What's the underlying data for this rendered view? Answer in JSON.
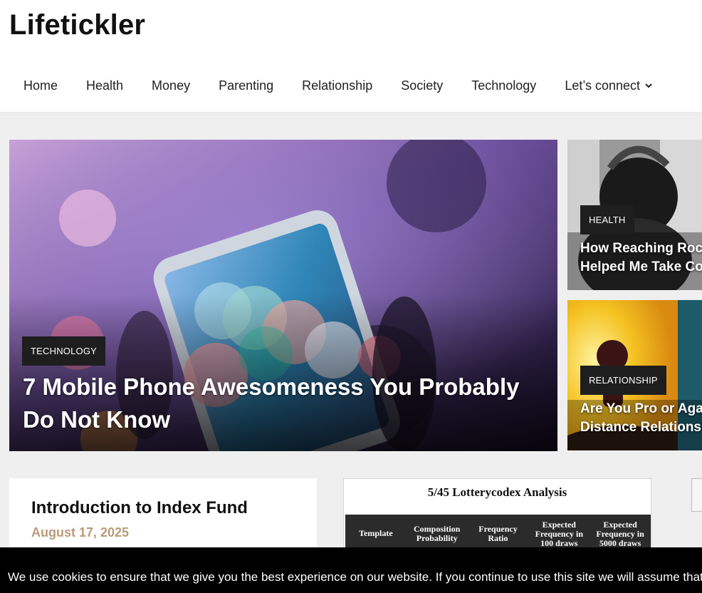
{
  "site": {
    "title": "Lifetickler"
  },
  "nav": {
    "items": [
      {
        "label": "Home"
      },
      {
        "label": "Health"
      },
      {
        "label": "Money"
      },
      {
        "label": "Parenting"
      },
      {
        "label": "Relationship"
      },
      {
        "label": "Society"
      },
      {
        "label": "Technology"
      },
      {
        "label": "Let’s connect",
        "icon": "chevron-down-icon"
      }
    ]
  },
  "hero": {
    "main": {
      "category": "TECHNOLOGY",
      "title": "7 Mobile Phone Awesomeness You Probably Do Not Know"
    },
    "side": [
      {
        "category": "HEALTH",
        "title_line1": "How Reaching Rock",
        "title_line2": "Helped Me Take Con"
      },
      {
        "category": "RELATIONSHIP",
        "title_line1": "Are You Pro or Again",
        "title_line2": "Distance Relationshi"
      }
    ]
  },
  "post": {
    "title": "Introduction to Index Fund",
    "date": "August 17, 2025"
  },
  "lotto": {
    "title": "5/45 Lotterycodex Analysis",
    "columns": [
      {
        "line1": "Template",
        "line2": "",
        "line3": ""
      },
      {
        "line1": "Composition",
        "line2": "Probability",
        "line3": ""
      },
      {
        "line1": "Frequency",
        "line2": "Ratio",
        "line3": ""
      },
      {
        "line1": "Expected",
        "line2": "Frequency in",
        "line3": "100 draws"
      },
      {
        "line1": "Expected",
        "line2": "Frequency in",
        "line3": "5000 draws"
      }
    ]
  },
  "cookie": {
    "text": "We use cookies to ensure that we give you the best experience on our website. If you continue to use this site we will assume that you are happy with it."
  }
}
